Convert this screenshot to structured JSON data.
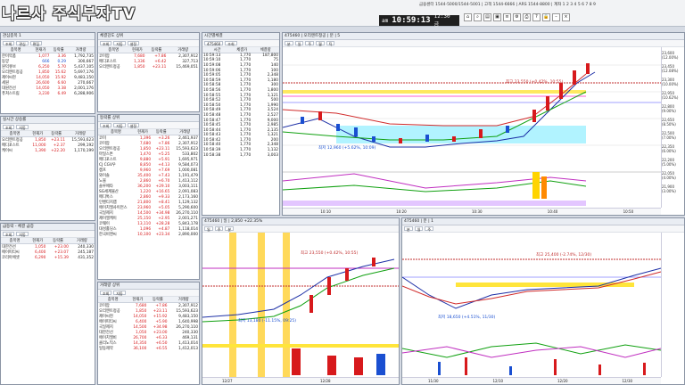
{
  "app": {
    "logo": "나르사 주식부자TV",
    "ticker": "금융센터 1544-5000/1544-5001 | 고객 1544-6666 | ARS 1544-8800 | 계좌 1 2 3 4 5 6 7 8 9",
    "clock_prefix": "am",
    "clock_time": "10:59:13",
    "clock_date": "12:30 금"
  },
  "watch1": {
    "title": "관심종목 1",
    "headers": [
      "종목명",
      "현재가",
      "등락률",
      "거래량"
    ],
    "rows": [
      {
        "name": "한미약품",
        "price": "1,077",
        "chg": "3.36",
        "vol": "1,792,735",
        "dir": "up"
      },
      {
        "name": "동양",
        "price": "666",
        "chg": "0.29",
        "vol": "300,667",
        "dir": "dn"
      },
      {
        "name": "원익큐브",
        "price": "6,250",
        "chg": "5.70",
        "vol": "5,437,105",
        "dir": "up"
      },
      {
        "name": "오리엔트정공",
        "price": "1,850",
        "chg": "15.62",
        "vol": "5,697,176",
        "dir": "up"
      },
      {
        "name": "제이씨현",
        "price": "14,050",
        "chg": "15.92",
        "vol": "9,483,150",
        "dir": "up"
      },
      {
        "name": "세원",
        "price": "26,600",
        "chg": "6.60",
        "vol": "270,667",
        "dir": "up"
      },
      {
        "name": "대원전선",
        "price": "14,050",
        "chg": "3.38",
        "vol": "2,001,176",
        "dir": "up"
      },
      {
        "name": "퓨쳐스트림",
        "price": "3,230",
        "chg": "6.49",
        "vol": "6,288,906",
        "dir": "up"
      }
    ]
  },
  "watch2": {
    "title": "실시간 상승률",
    "headers": [
      "종목명",
      "현재가",
      "등락률",
      "거래량"
    ],
    "rows": [
      {
        "name": "오리엔트정공",
        "price": "1,850",
        "chg": "+23.11",
        "vol": "15,593,623",
        "dir": "up"
      },
      {
        "name": "메디포스트",
        "price": "11,000",
        "chg": "+2.37",
        "vol": "299,192",
        "dir": "up"
      },
      {
        "name": "케이씨",
        "price": "1,390",
        "chg": "+22.20",
        "vol": "1,170,199",
        "dir": "up"
      }
    ]
  },
  "watch3": {
    "title": "급등락 - 체결 급증",
    "headers": [
      "종목명",
      "현재가",
      "등락률",
      "거래량"
    ],
    "rows": [
      {
        "name": "대한전선",
        "price": "1,050",
        "chg": "+23.00",
        "vol": "240,330",
        "dir": "up"
      },
      {
        "name": "에이피티씨",
        "price": "6,400",
        "chg": "+23.07",
        "vol": "245,187",
        "dir": "up"
      },
      {
        "name": "코리아에셋",
        "price": "6,290",
        "chg": "+15.39",
        "vol": "431,352",
        "dir": "up"
      }
    ]
  },
  "rank1": {
    "title": "체결강도 상위",
    "headers": [
      "종목명",
      "현재가",
      "등락률",
      "거래량"
    ],
    "rows": [
      {
        "name": "코미팜",
        "price": "7,680",
        "chg": "+7.86",
        "vol": "2,307,912",
        "dir": "up"
      },
      {
        "name": "메디포스트",
        "price": "1,336",
        "chg": "+6.42",
        "vol": "327,713",
        "dir": "up"
      },
      {
        "name": "오리엔트정공",
        "price": "1,850",
        "chg": "+23.11",
        "vol": "15,469,051",
        "dir": "up"
      }
    ]
  },
  "rank2": {
    "title": "등락률 상위",
    "headers": [
      "종목명",
      "현재가",
      "등락률",
      "거래량"
    ],
    "rows": [
      {
        "name": "코미",
        "price": "1,396",
        "chg": "+3.26",
        "vol": "2,461,937",
        "dir": "up"
      },
      {
        "name": "코미팜",
        "price": "7,680",
        "chg": "+7.86",
        "vol": "2,307,912",
        "dir": "up"
      },
      {
        "name": "오리엔트정공",
        "price": "1,850",
        "chg": "+23.11",
        "vol": "15,593,623",
        "dir": "up"
      },
      {
        "name": "마일스톤",
        "price": "1,470",
        "chg": "+5.25",
        "vol": "533,802",
        "dir": "up"
      },
      {
        "name": "메디포스트",
        "price": "9,880",
        "chg": "+5.91",
        "vol": "1,695,971",
        "dir": "up"
      },
      {
        "name": "CJ CGV우",
        "price": "8,850",
        "chg": "+4.13",
        "vol": "9,584,073",
        "dir": "up"
      },
      {
        "name": "캠프",
        "price": "9,960",
        "chg": "+7.69",
        "vol": "1,000,081",
        "dir": "up"
      },
      {
        "name": "와이솔",
        "price": "35,400",
        "chg": "+7.43",
        "vol": "1,191,479",
        "dir": "up"
      },
      {
        "name": "노블",
        "price": "2,860",
        "chg": "+6.70",
        "vol": "1,413,112",
        "dir": "up"
      },
      {
        "name": "솔루에타",
        "price": "36,200",
        "chg": "+29.10",
        "vol": "3,003,111",
        "dir": "up"
      },
      {
        "name": "SG세계물산",
        "price": "1,220",
        "chg": "+16.65",
        "vol": "2,091,083",
        "dir": "up"
      },
      {
        "name": "메디톡스",
        "price": "2,860",
        "chg": "+9.33",
        "vol": "2,173,160",
        "dir": "up"
      },
      {
        "name": "인벤티지랩",
        "price": "21,800",
        "chg": "+8.41",
        "vol": "1,129,132",
        "dir": "up"
      },
      {
        "name": "에이치엘사이언스",
        "price": "23,960",
        "chg": "+5.05",
        "vol": "5,290,600",
        "dir": "up"
      },
      {
        "name": "국일제지",
        "price": "14,500",
        "chg": "+34.98",
        "vol": "26,270,110",
        "dir": "up"
      },
      {
        "name": "제이엘케이",
        "price": "25,150",
        "chg": "+2.95",
        "vol": "2,001,271",
        "dir": "up"
      },
      {
        "name": "코웨이",
        "price": "13,110",
        "chg": "+28.28",
        "vol": "5,843,178",
        "dir": "up"
      },
      {
        "name": "대성홀딩스",
        "price": "1,096",
        "chg": "+4.87",
        "vol": "1,118,014",
        "dir": "up"
      },
      {
        "name": "한국비엔씨",
        "price": "10,100",
        "chg": "+23.34",
        "vol": "2,890,000",
        "dir": "up"
      }
    ]
  },
  "rank3": {
    "title": "거래량 상위",
    "headers": [
      "종목명",
      "현재가",
      "등락률",
      "거래량"
    ],
    "rows": [
      {
        "name": "코미팜",
        "price": "7,680",
        "chg": "+7.86",
        "vol": "2,307,912",
        "dir": "up"
      },
      {
        "name": "오리엔트정공",
        "price": "1,850",
        "chg": "+23.11",
        "vol": "15,593,623",
        "dir": "up"
      },
      {
        "name": "제이씨현",
        "price": "14,050",
        "chg": "+15.92",
        "vol": "9,483,150",
        "dir": "up"
      },
      {
        "name": "에이피티씨",
        "price": "6,400",
        "chg": "+5.90",
        "vol": "1,640,998",
        "dir": "up"
      },
      {
        "name": "국일제지",
        "price": "14,500",
        "chg": "+34.98",
        "vol": "26,270,110",
        "dir": "up"
      },
      {
        "name": "대한전선",
        "price": "1,050",
        "chg": "+23.00",
        "vol": "240,330",
        "dir": "up"
      },
      {
        "name": "에이치엘비",
        "price": "26,700",
        "chg": "+6.33",
        "vol": "469,131",
        "dir": "up"
      },
      {
        "name": "클리노믹스",
        "price": "14,350",
        "chg": "+6.50",
        "vol": "1,413,014",
        "dir": "up"
      },
      {
        "name": "일동제약",
        "price": "36,100",
        "chg": "+6.55",
        "vol": "1,412,013",
        "dir": "up"
      }
    ]
  },
  "ticks": {
    "title": "시간별체결",
    "headers": [
      "시간",
      "체결가",
      "체결량"
    ],
    "rows": [
      {
        "t": "10:59:13",
        "p": "1,770",
        "v": "187,800"
      },
      {
        "t": "10:59:10",
        "p": "1,770",
        "v": "75"
      },
      {
        "t": "10:59:08",
        "p": "1,770",
        "v": "140"
      },
      {
        "t": "10:59:06",
        "p": "1,770",
        "v": "100"
      },
      {
        "t": "10:59:05",
        "p": "1,770",
        "v": "2,348"
      },
      {
        "t": "10:58:59",
        "p": "1,770",
        "v": "1,180"
      },
      {
        "t": "10:58:58",
        "p": "1,770",
        "v": "300"
      },
      {
        "t": "10:58:56",
        "p": "1,770",
        "v": "1,800"
      },
      {
        "t": "10:58:55",
        "p": "1,770",
        "v": "1,121"
      },
      {
        "t": "10:58:52",
        "p": "1,770",
        "v": "500"
      },
      {
        "t": "10:58:50",
        "p": "1,770",
        "v": "1,990"
      },
      {
        "t": "10:58:49",
        "p": "1,770",
        "v": "3,524"
      },
      {
        "t": "10:58:48",
        "p": "1,770",
        "v": "2,527"
      },
      {
        "t": "10:58:47",
        "p": "1,770",
        "v": "9,000"
      },
      {
        "t": "10:58:45",
        "p": "1,770",
        "v": "2,985"
      },
      {
        "t": "10:58:44",
        "p": "1,770",
        "v": "2,135"
      },
      {
        "t": "10:58:43",
        "p": "1,770",
        "v": "1,321"
      },
      {
        "t": "10:58:42",
        "p": "1,770",
        "v": "200"
      },
      {
        "t": "10:58:40",
        "p": "1,770",
        "v": "2,348"
      },
      {
        "t": "10:58:39",
        "p": "1,770",
        "v": "1,132"
      },
      {
        "t": "10:58:38",
        "p": "1,770",
        "v": "3,003"
      }
    ]
  },
  "chart_main": {
    "title": "475460 | 오리엔트정공 | 분 | 5",
    "label_high": "최고 23,550 (+0.42%, 10:55)",
    "label_low": "최저 12,960 (+5.62%, 10:09)",
    "yticks": [
      "23,600 (12.00%)",
      "23,450 (12.08%)",
      "23,300 (10.00%)",
      "22,950 (10.62%)",
      "22,800 (9.00%)",
      "22,650 (8.50%)",
      "22,500 (7.00%)",
      "22,350 (6.00%)",
      "22,200 (5.00%)",
      "22,050 (4.00%)",
      "21,900 (3.00%)"
    ],
    "xticks": [
      "10:10",
      "10:20",
      "10:30",
      "10:40",
      "10:50"
    ]
  },
  "chart_bl": {
    "title": "475460 | 일 | 2,850 +22.35%",
    "label_high": "최고 23,550 (+0.42%, 10:55)",
    "label_low": "최저 13,180 (-11.15%, 09:25)",
    "xticks": [
      "12/27",
      "12/28"
    ]
  },
  "chart_br": {
    "title": "475460 | 분 | 1",
    "label_high": "최고 25,400 (-2.74%, 12/30)",
    "label_low": "최저 18,650 (+4.51%, 11/30)",
    "xticks": [
      "11/30",
      "12/10",
      "12/20",
      "12/30"
    ]
  }
}
